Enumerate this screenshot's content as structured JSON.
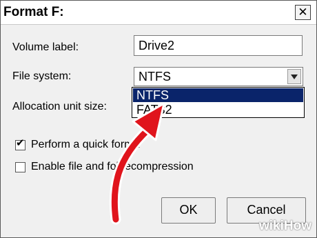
{
  "window": {
    "title": "Format F:",
    "close_glyph": "✕"
  },
  "form": {
    "volume_label": "Volume label:",
    "volume_value": "Drive2",
    "file_system_label": "File system:",
    "file_system_value": "NTFS",
    "file_system_options": [
      "NTFS",
      "FAT32"
    ],
    "allocation_label": "Allocation unit size:",
    "quick_format_label": "Perform a quick forma",
    "quick_format_checked": true,
    "compression_label_a": "Enable file and folde",
    "compression_label_b": "compression",
    "compression_checked": false
  },
  "buttons": {
    "ok": "OK",
    "cancel": "Cancel"
  },
  "watermark": "wikiHow",
  "colors": {
    "selection": "#0a246a",
    "annotation_arrow": "#e0141c"
  }
}
